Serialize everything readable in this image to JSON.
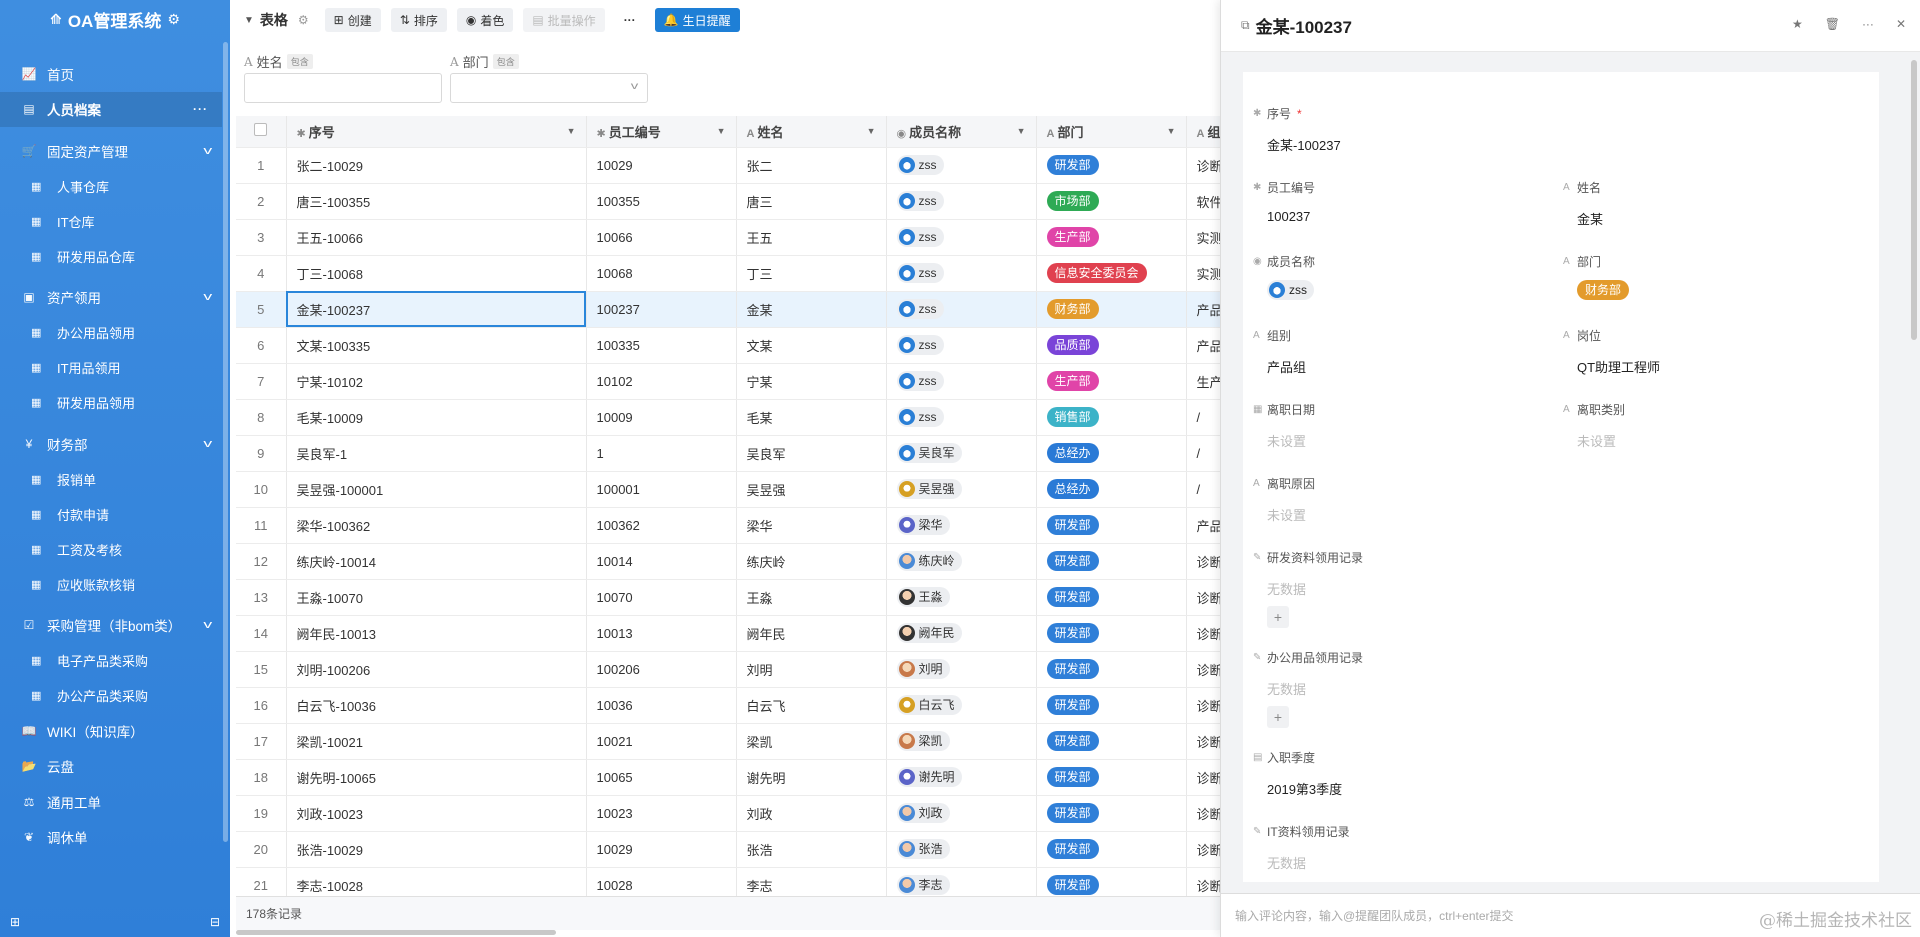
{
  "app": {
    "title": "OA管理系统"
  },
  "sidebar": {
    "items": [
      {
        "icon": "line-chart-icon",
        "glyph": "📈",
        "label": "首页",
        "type": "item"
      },
      {
        "icon": "id-card-icon",
        "glyph": "▤",
        "label": "人员档案",
        "type": "item",
        "active": true
      },
      {
        "icon": "cart-icon",
        "glyph": "🛒",
        "label": "固定资产管理",
        "type": "group"
      },
      {
        "icon": "table-icon",
        "glyph": "▦",
        "label": "人事仓库",
        "type": "sub"
      },
      {
        "icon": "table-icon",
        "glyph": "▦",
        "label": "IT仓库",
        "type": "sub"
      },
      {
        "icon": "table-icon",
        "glyph": "▦",
        "label": "研发用品仓库",
        "type": "sub"
      },
      {
        "icon": "calendar-check-icon",
        "glyph": "▣",
        "label": "资产领用",
        "type": "group"
      },
      {
        "icon": "table-icon",
        "glyph": "▦",
        "label": "办公用品领用",
        "type": "sub"
      },
      {
        "icon": "table-icon",
        "glyph": "▦",
        "label": "IT用品领用",
        "type": "sub"
      },
      {
        "icon": "table-icon",
        "glyph": "▦",
        "label": "研发用品领用",
        "type": "sub"
      },
      {
        "icon": "yen-icon",
        "glyph": "¥",
        "label": "财务部",
        "type": "group"
      },
      {
        "icon": "table-icon",
        "glyph": "▦",
        "label": "报销单",
        "type": "sub"
      },
      {
        "icon": "table-icon",
        "glyph": "▦",
        "label": "付款申请",
        "type": "sub"
      },
      {
        "icon": "table-icon",
        "glyph": "▦",
        "label": "工资及考核",
        "type": "sub"
      },
      {
        "icon": "table-icon",
        "glyph": "▦",
        "label": "应收账款核销",
        "type": "sub"
      },
      {
        "icon": "checkbox-icon",
        "glyph": "☑",
        "label": "采购管理（非bom类）",
        "type": "group"
      },
      {
        "icon": "table-icon",
        "glyph": "▦",
        "label": "电子产品类采购",
        "type": "sub"
      },
      {
        "icon": "table-icon",
        "glyph": "▦",
        "label": "办公产品类采购",
        "type": "sub"
      },
      {
        "icon": "book-icon",
        "glyph": "📖",
        "label": "WIKI（知识库）",
        "type": "item"
      },
      {
        "icon": "folder-open-icon",
        "glyph": "📂",
        "label": "云盘",
        "type": "item"
      },
      {
        "icon": "scale-icon",
        "glyph": "⚖",
        "label": "通用工单",
        "type": "item"
      },
      {
        "icon": "leaf-icon",
        "glyph": "❦",
        "label": "调休单",
        "type": "item"
      }
    ]
  },
  "toolbar": {
    "view_title": "表格",
    "create": "创建",
    "sort": "排序",
    "color": "着色",
    "batch": "批量操作",
    "more": "···",
    "birthday": "生日提醒"
  },
  "filters": {
    "name_label": "姓名",
    "dept_label": "部门",
    "contains": "包含"
  },
  "table": {
    "headers": [
      "序号",
      "员工编号",
      "姓名",
      "成员名称",
      "部门",
      "组别"
    ],
    "rows": [
      [
        "1",
        "张二-10029",
        "10029",
        "张二",
        "zss",
        "研发部",
        "诊断"
      ],
      [
        "2",
        "唐三-100355",
        "100355",
        "唐三",
        "zss",
        "市场部",
        "软件"
      ],
      [
        "3",
        "王五-10066",
        "10066",
        "王五",
        "zss",
        "生产部",
        "实测"
      ],
      [
        "4",
        "丁三-10068",
        "10068",
        "丁三",
        "zss",
        "信息安全委员会",
        "实测"
      ],
      [
        "5",
        "金某-100237",
        "100237",
        "金某",
        "zss",
        "财务部",
        "产品"
      ],
      [
        "6",
        "文某-100335",
        "100335",
        "文某",
        "zss",
        "品质部",
        "产品"
      ],
      [
        "7",
        "宁某-10102",
        "10102",
        "宁某",
        "zss",
        "生产部",
        "生产"
      ],
      [
        "8",
        "毛某-10009",
        "10009",
        "毛某",
        "zss",
        "销售部",
        "/"
      ],
      [
        "9",
        "吴良军-1",
        "1",
        "吴良军",
        "吴良军",
        "总经办",
        "/"
      ],
      [
        "10",
        "吴昱强-100001",
        "100001",
        "吴昱强",
        "吴昱强",
        "总经办",
        "/"
      ],
      [
        "11",
        "梁华-100362",
        "100362",
        "梁华",
        "梁华",
        "研发部",
        "产品"
      ],
      [
        "12",
        "练庆岭-10014",
        "10014",
        "练庆岭",
        "练庆岭",
        "研发部",
        "诊断"
      ],
      [
        "13",
        "王淼-10070",
        "10070",
        "王淼",
        "王淼",
        "研发部",
        "诊断"
      ],
      [
        "14",
        "阙年民-10013",
        "10013",
        "阙年民",
        "阙年民",
        "研发部",
        "诊断"
      ],
      [
        "15",
        "刘明-100206",
        "100206",
        "刘明",
        "刘明",
        "研发部",
        "诊断"
      ],
      [
        "16",
        "白云飞-10036",
        "10036",
        "白云飞",
        "白云飞",
        "研发部",
        "诊断"
      ],
      [
        "17",
        "梁凯-10021",
        "10021",
        "梁凯",
        "梁凯",
        "研发部",
        "诊断"
      ],
      [
        "18",
        "谢先明-10065",
        "10065",
        "谢先明",
        "谢先明",
        "研发部",
        "诊断"
      ],
      [
        "19",
        "刘政-10023",
        "10023",
        "刘政",
        "刘政",
        "研发部",
        "诊断"
      ],
      [
        "20",
        "张浩-10029",
        "10029",
        "张浩",
        "张浩",
        "研发部",
        "诊断"
      ],
      [
        "21",
        "李志-10028",
        "10028",
        "李志",
        "李志",
        "研发部",
        "诊断"
      ]
    ],
    "footer": "178条记录"
  },
  "dept_colors": {
    "研发部": "#2f7fd8",
    "市场部": "#2eaa55",
    "生产部": "#e044a8",
    "信息安全委员会": "#e0414f",
    "财务部": "#e39b2c",
    "品质部": "#7a44d8",
    "销售部": "#3cb3c8",
    "总经办": "#2a7ad6"
  },
  "detail": {
    "title": "金某-100237",
    "fields": {
      "seq_label": "序号",
      "seq_value": "金某-100237",
      "emp_label": "员工编号",
      "emp_value": "100237",
      "name_label": "姓名",
      "name_value": "金某",
      "member_label": "成员名称",
      "member_value": "zss",
      "dept_label": "部门",
      "dept_value": "财务部",
      "group_label": "组别",
      "group_value": "产品组",
      "post_label": "岗位",
      "post_value": "QT助理工程师",
      "leave_date_label": "离职日期",
      "leave_date_value": "未设置",
      "leave_type_label": "离职类别",
      "leave_type_value": "未设置",
      "leave_reason_label": "离职原因",
      "leave_reason_value": "未设置",
      "rd_label": "研发资料领用记录",
      "rd_value": "无数据",
      "office_label": "办公用品领用记录",
      "office_value": "无数据",
      "entry_label": "入职季度",
      "entry_value": "2019第3季度",
      "it_label": "IT资料领用记录",
      "it_value": "无数据"
    },
    "comment_placeholder": "输入评论内容，输入@提醒团队成员，ctrl+enter提交"
  },
  "watermark": "@稀土掘金技术社区"
}
